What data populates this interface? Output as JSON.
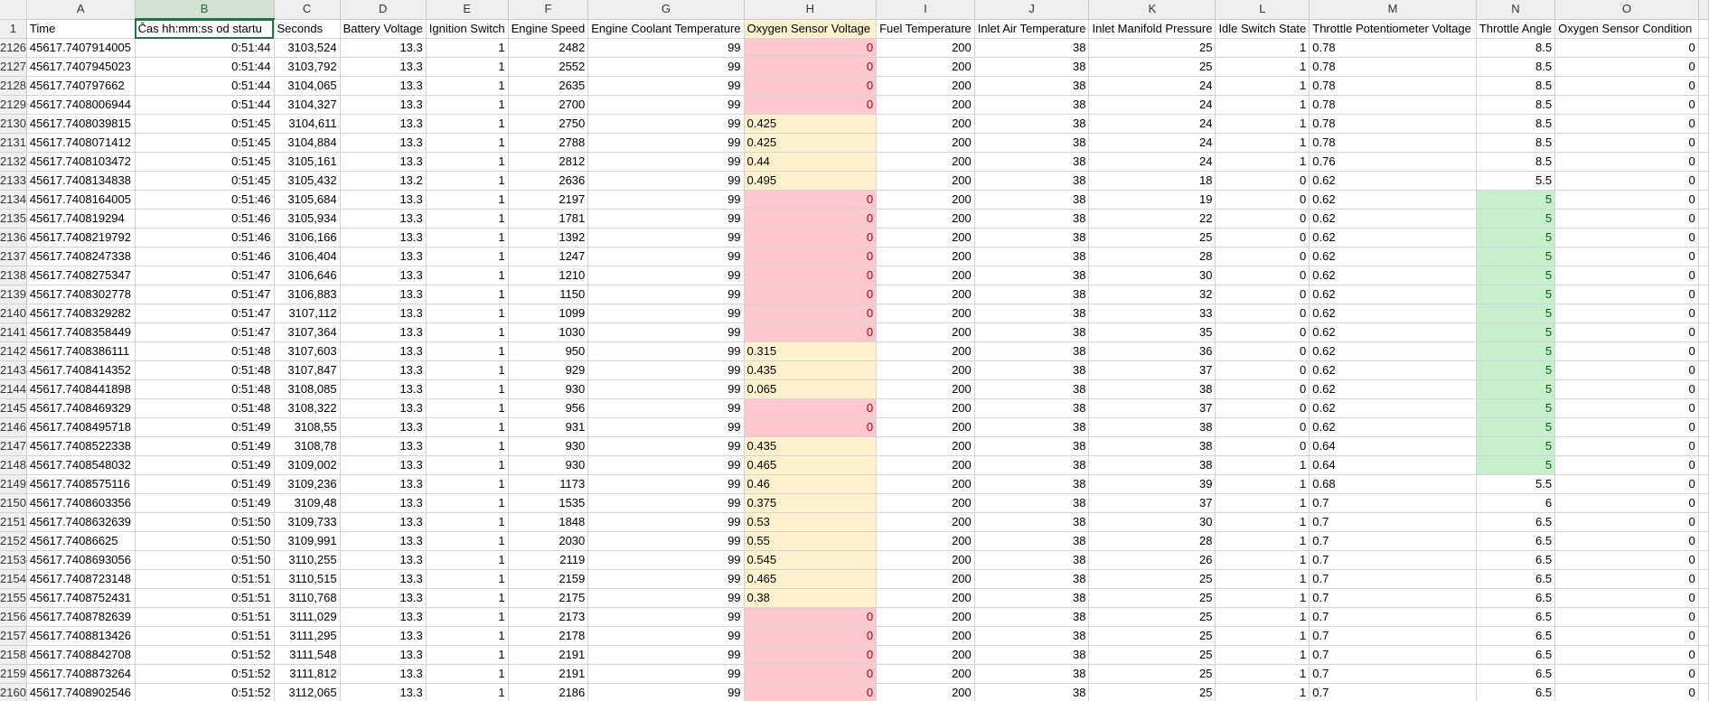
{
  "sheet": {
    "column_letters": [
      "A",
      "B",
      "C",
      "D",
      "E",
      "F",
      "G",
      "H",
      "I",
      "J",
      "K",
      "L",
      "M",
      "N",
      "O"
    ],
    "selected_column": "B",
    "header_row_number": "1",
    "headers": [
      "Time",
      "Čas hh:mm:ss od startu",
      "Seconds",
      "Battery Voltage",
      "Ignition Switch",
      "Engine Speed",
      "Engine Coolant Temperature",
      "Oxygen Sensor Voltage",
      "Fuel Temperature",
      "Inlet Air Temperature",
      "Inlet Manifold Pressure",
      "Idle Switch State",
      "Throttle Potentiometer Voltage",
      "Throttle Angle",
      "Oxygen Sensor Condition"
    ],
    "colors": {
      "red_fill": "#ffc7ce",
      "yellow_fill": "#fff2cc",
      "green_fill": "#c6efce",
      "selected": "#217346"
    },
    "rows": [
      {
        "n": "2126",
        "c": [
          "45617.7407914005",
          "0:51:44",
          "3103,524",
          "13.3",
          "1",
          "2482",
          "99",
          "0",
          "200",
          "38",
          "25",
          "1",
          "0.78",
          "8.5",
          "0"
        ]
      },
      {
        "n": "2127",
        "c": [
          "45617.7407945023",
          "0:51:44",
          "3103,792",
          "13.3",
          "1",
          "2552",
          "99",
          "0",
          "200",
          "38",
          "25",
          "1",
          "0.78",
          "8.5",
          "0"
        ]
      },
      {
        "n": "2128",
        "c": [
          "45617.740797662",
          "0:51:44",
          "3104,065",
          "13.3",
          "1",
          "2635",
          "99",
          "0",
          "200",
          "38",
          "24",
          "1",
          "0.78",
          "8.5",
          "0"
        ]
      },
      {
        "n": "2129",
        "c": [
          "45617.7408006944",
          "0:51:44",
          "3104,327",
          "13.3",
          "1",
          "2700",
          "99",
          "0",
          "200",
          "38",
          "24",
          "1",
          "0.78",
          "8.5",
          "0"
        ]
      },
      {
        "n": "2130",
        "c": [
          "45617.7408039815",
          "0:51:45",
          "3104,611",
          "13.3",
          "1",
          "2750",
          "99",
          "0.425",
          "200",
          "38",
          "24",
          "1",
          "0.78",
          "8.5",
          "0"
        ]
      },
      {
        "n": "2131",
        "c": [
          "45617.7408071412",
          "0:51:45",
          "3104,884",
          "13.3",
          "1",
          "2788",
          "99",
          "0.425",
          "200",
          "38",
          "24",
          "1",
          "0.78",
          "8.5",
          "0"
        ]
      },
      {
        "n": "2132",
        "c": [
          "45617.7408103472",
          "0:51:45",
          "3105,161",
          "13.3",
          "1",
          "2812",
          "99",
          "0.44",
          "200",
          "38",
          "24",
          "1",
          "0.76",
          "8.5",
          "0"
        ]
      },
      {
        "n": "2133",
        "c": [
          "45617.7408134838",
          "0:51:45",
          "3105,432",
          "13.2",
          "1",
          "2636",
          "99",
          "0.495",
          "200",
          "38",
          "18",
          "0",
          "0.62",
          "5.5",
          "0"
        ]
      },
      {
        "n": "2134",
        "c": [
          "45617.7408164005",
          "0:51:46",
          "3105,684",
          "13.3",
          "1",
          "2197",
          "99",
          "0",
          "200",
          "38",
          "19",
          "0",
          "0.62",
          "5",
          "0"
        ]
      },
      {
        "n": "2135",
        "c": [
          "45617.740819294",
          "0:51:46",
          "3105,934",
          "13.3",
          "1",
          "1781",
          "99",
          "0",
          "200",
          "38",
          "22",
          "0",
          "0.62",
          "5",
          "0"
        ]
      },
      {
        "n": "2136",
        "c": [
          "45617.7408219792",
          "0:51:46",
          "3106,166",
          "13.3",
          "1",
          "1392",
          "99",
          "0",
          "200",
          "38",
          "25",
          "0",
          "0.62",
          "5",
          "0"
        ]
      },
      {
        "n": "2137",
        "c": [
          "45617.7408247338",
          "0:51:46",
          "3106,404",
          "13.3",
          "1",
          "1247",
          "99",
          "0",
          "200",
          "38",
          "28",
          "0",
          "0.62",
          "5",
          "0"
        ]
      },
      {
        "n": "2138",
        "c": [
          "45617.7408275347",
          "0:51:47",
          "3106,646",
          "13.3",
          "1",
          "1210",
          "99",
          "0",
          "200",
          "38",
          "30",
          "0",
          "0.62",
          "5",
          "0"
        ]
      },
      {
        "n": "2139",
        "c": [
          "45617.7408302778",
          "0:51:47",
          "3106,883",
          "13.3",
          "1",
          "1150",
          "99",
          "0",
          "200",
          "38",
          "32",
          "0",
          "0.62",
          "5",
          "0"
        ]
      },
      {
        "n": "2140",
        "c": [
          "45617.7408329282",
          "0:51:47",
          "3107,112",
          "13.3",
          "1",
          "1099",
          "99",
          "0",
          "200",
          "38",
          "33",
          "0",
          "0.62",
          "5",
          "0"
        ]
      },
      {
        "n": "2141",
        "c": [
          "45617.7408358449",
          "0:51:47",
          "3107,364",
          "13.3",
          "1",
          "1030",
          "99",
          "0",
          "200",
          "38",
          "35",
          "0",
          "0.62",
          "5",
          "0"
        ]
      },
      {
        "n": "2142",
        "c": [
          "45617.7408386111",
          "0:51:48",
          "3107,603",
          "13.3",
          "1",
          "950",
          "99",
          "0.315",
          "200",
          "38",
          "36",
          "0",
          "0.62",
          "5",
          "0"
        ]
      },
      {
        "n": "2143",
        "c": [
          "45617.7408414352",
          "0:51:48",
          "3107,847",
          "13.3",
          "1",
          "929",
          "99",
          "0.435",
          "200",
          "38",
          "37",
          "0",
          "0.62",
          "5",
          "0"
        ]
      },
      {
        "n": "2144",
        "c": [
          "45617.7408441898",
          "0:51:48",
          "3108,085",
          "13.3",
          "1",
          "930",
          "99",
          "0.065",
          "200",
          "38",
          "38",
          "0",
          "0.62",
          "5",
          "0"
        ]
      },
      {
        "n": "2145",
        "c": [
          "45617.7408469329",
          "0:51:48",
          "3108,322",
          "13.3",
          "1",
          "956",
          "99",
          "0",
          "200",
          "38",
          "37",
          "0",
          "0.62",
          "5",
          "0"
        ]
      },
      {
        "n": "2146",
        "c": [
          "45617.7408495718",
          "0:51:49",
          "3108,55",
          "13.3",
          "1",
          "931",
          "99",
          "0",
          "200",
          "38",
          "38",
          "0",
          "0.62",
          "5",
          "0"
        ]
      },
      {
        "n": "2147",
        "c": [
          "45617.7408522338",
          "0:51:49",
          "3108,78",
          "13.3",
          "1",
          "930",
          "99",
          "0.435",
          "200",
          "38",
          "38",
          "0",
          "0.64",
          "5",
          "0"
        ]
      },
      {
        "n": "2148",
        "c": [
          "45617.7408548032",
          "0:51:49",
          "3109,002",
          "13.3",
          "1",
          "930",
          "99",
          "0.465",
          "200",
          "38",
          "38",
          "1",
          "0.64",
          "5",
          "0"
        ]
      },
      {
        "n": "2149",
        "c": [
          "45617.7408575116",
          "0:51:49",
          "3109,236",
          "13.3",
          "1",
          "1173",
          "99",
          "0.46",
          "200",
          "38",
          "39",
          "1",
          "0.68",
          "5.5",
          "0"
        ]
      },
      {
        "n": "2150",
        "c": [
          "45617.7408603356",
          "0:51:49",
          "3109,48",
          "13.3",
          "1",
          "1535",
          "99",
          "0.375",
          "200",
          "38",
          "37",
          "1",
          "0.7",
          "6",
          "0"
        ]
      },
      {
        "n": "2151",
        "c": [
          "45617.7408632639",
          "0:51:50",
          "3109,733",
          "13.3",
          "1",
          "1848",
          "99",
          "0.53",
          "200",
          "38",
          "30",
          "1",
          "0.7",
          "6.5",
          "0"
        ]
      },
      {
        "n": "2152",
        "c": [
          "45617.74086625",
          "0:51:50",
          "3109,991",
          "13.3",
          "1",
          "2030",
          "99",
          "0.55",
          "200",
          "38",
          "28",
          "1",
          "0.7",
          "6.5",
          "0"
        ]
      },
      {
        "n": "2153",
        "c": [
          "45617.7408693056",
          "0:51:50",
          "3110,255",
          "13.3",
          "1",
          "2119",
          "99",
          "0.545",
          "200",
          "38",
          "26",
          "1",
          "0.7",
          "6.5",
          "0"
        ]
      },
      {
        "n": "2154",
        "c": [
          "45617.7408723148",
          "0:51:51",
          "3110,515",
          "13.3",
          "1",
          "2159",
          "99",
          "0.465",
          "200",
          "38",
          "25",
          "1",
          "0.7",
          "6.5",
          "0"
        ]
      },
      {
        "n": "2155",
        "c": [
          "45617.7408752431",
          "0:51:51",
          "3110,768",
          "13.3",
          "1",
          "2175",
          "99",
          "0.38",
          "200",
          "38",
          "25",
          "1",
          "0.7",
          "6.5",
          "0"
        ]
      },
      {
        "n": "2156",
        "c": [
          "45617.7408782639",
          "0:51:51",
          "3111,029",
          "13.3",
          "1",
          "2173",
          "99",
          "0",
          "200",
          "38",
          "25",
          "1",
          "0.7",
          "6.5",
          "0"
        ]
      },
      {
        "n": "2157",
        "c": [
          "45617.7408813426",
          "0:51:51",
          "3111,295",
          "13.3",
          "1",
          "2178",
          "99",
          "0",
          "200",
          "38",
          "25",
          "1",
          "0.7",
          "6.5",
          "0"
        ]
      },
      {
        "n": "2158",
        "c": [
          "45617.7408842708",
          "0:51:52",
          "3111,548",
          "13.3",
          "1",
          "2191",
          "99",
          "0",
          "200",
          "38",
          "25",
          "1",
          "0.7",
          "6.5",
          "0"
        ]
      },
      {
        "n": "2159",
        "c": [
          "45617.7408873264",
          "0:51:52",
          "3111,812",
          "13.3",
          "1",
          "2191",
          "99",
          "0",
          "200",
          "38",
          "25",
          "1",
          "0.7",
          "6.5",
          "0"
        ]
      },
      {
        "n": "2160",
        "c": [
          "45617.7408902546",
          "0:51:52",
          "3112,065",
          "13.3",
          "1",
          "2186",
          "99",
          "0",
          "200",
          "38",
          "25",
          "1",
          "0.7",
          "6.5",
          "0"
        ]
      }
    ]
  }
}
